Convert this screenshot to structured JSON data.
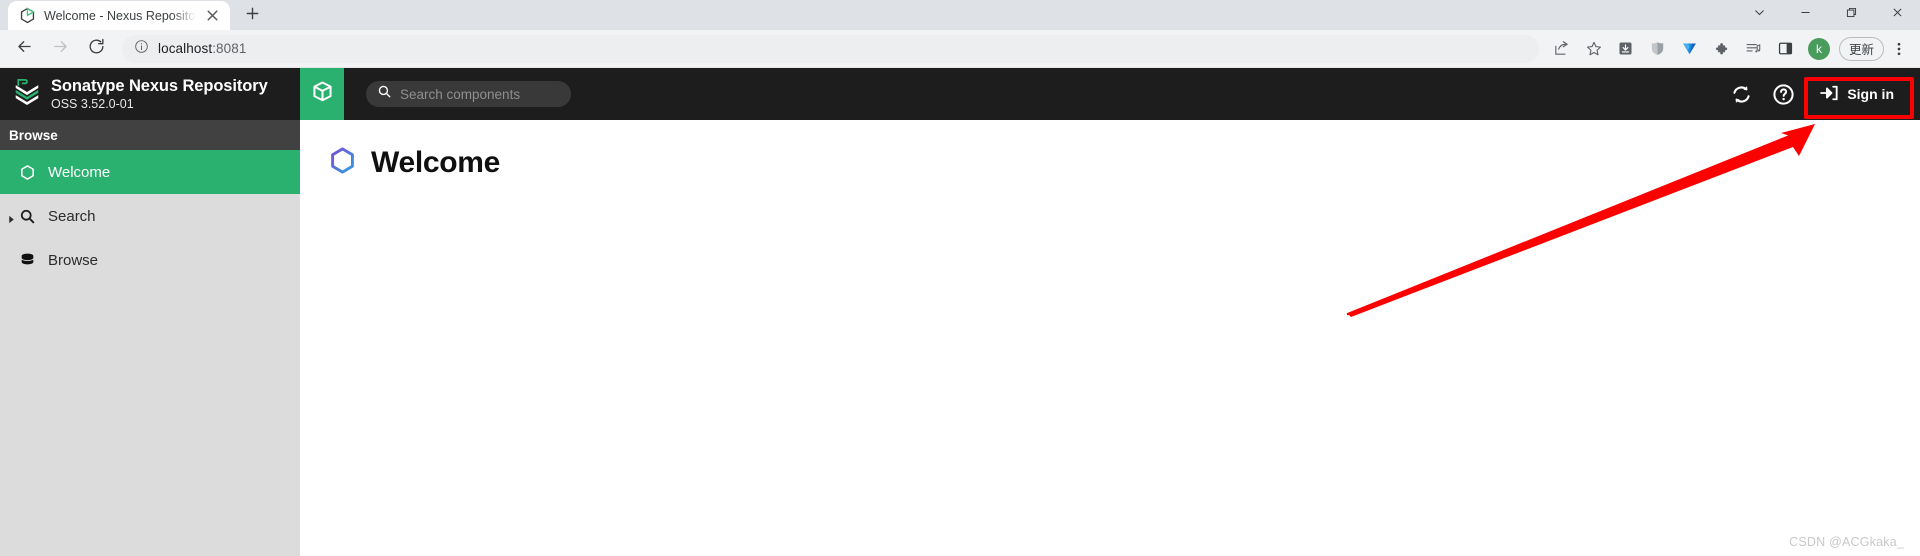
{
  "browser": {
    "tab": {
      "title": "Welcome - Nexus Repository ",
      "favicon_icon": "nexus-hexagon-favicon",
      "close_icon": "close-icon"
    },
    "new_tab_icon": "plus-icon",
    "window_controls": [
      {
        "name": "tab-search",
        "icon": "chevron-down-icon"
      },
      {
        "name": "minimize",
        "icon": "minimize-icon"
      },
      {
        "name": "maximize",
        "icon": "restore-icon"
      },
      {
        "name": "close",
        "icon": "close-icon"
      }
    ],
    "nav": {
      "back_icon": "arrow-left-icon",
      "forward_icon": "arrow-right-icon",
      "reload_icon": "reload-icon"
    },
    "omnibox": {
      "info_icon": "info-circle-icon",
      "host": "localhost",
      "port": ":8081",
      "full_url": "localhost:8081"
    },
    "toolbar_icons": [
      {
        "name": "share-icon",
        "label": "Share"
      },
      {
        "name": "bookmark-star-icon",
        "label": "Bookmark this tab"
      },
      {
        "name": "download-icon",
        "label": "Downloads"
      },
      {
        "name": "shield-grey-icon",
        "label": "Extension"
      },
      {
        "name": "diamond-blue-icon",
        "label": "Extension"
      },
      {
        "name": "puzzle-piece-icon",
        "label": "Extensions"
      },
      {
        "name": "playlist-music-icon",
        "label": "Extension"
      },
      {
        "name": "side-panel-icon",
        "label": "Side panel"
      }
    ],
    "avatar": {
      "initial": "k",
      "color": "#4a9c5c"
    },
    "update_button": {
      "label": "更新"
    },
    "menu_icon": "three-dot-menu-icon"
  },
  "nexus": {
    "brand": {
      "logo_icon": "sonatype-chevron-logo",
      "name": "Sonatype Nexus Repository",
      "version": "OSS 3.52.0-01"
    },
    "module_tab": {
      "icon": "cube-box-icon",
      "color": "#2ab06f"
    },
    "search": {
      "icon": "search-icon",
      "placeholder": "Search components",
      "value": ""
    },
    "header_actions": [
      {
        "name": "refresh-icon",
        "label": "Refresh"
      },
      {
        "name": "help-circle-icon",
        "label": "Help"
      }
    ],
    "signin": {
      "icon": "sign-in-arrow-icon",
      "label": "Sign in"
    },
    "sidebar": {
      "section_title": "Browse",
      "items": [
        {
          "label": "Welcome",
          "icon": "hexagon-icon",
          "active": true,
          "expandable": false
        },
        {
          "label": "Search",
          "icon": "search-icon",
          "active": false,
          "expandable": true
        },
        {
          "label": "Browse",
          "icon": "database-icon",
          "active": false,
          "expandable": false
        }
      ]
    },
    "page": {
      "heading_icon": "hexagon-gradient-icon",
      "heading": "Welcome"
    }
  },
  "annotations": {
    "highlight_color": "#fd0000",
    "arrow_color": "#fd0000",
    "arrow_target": "Sign in",
    "watermark": "CSDN @ACGkaka_"
  }
}
